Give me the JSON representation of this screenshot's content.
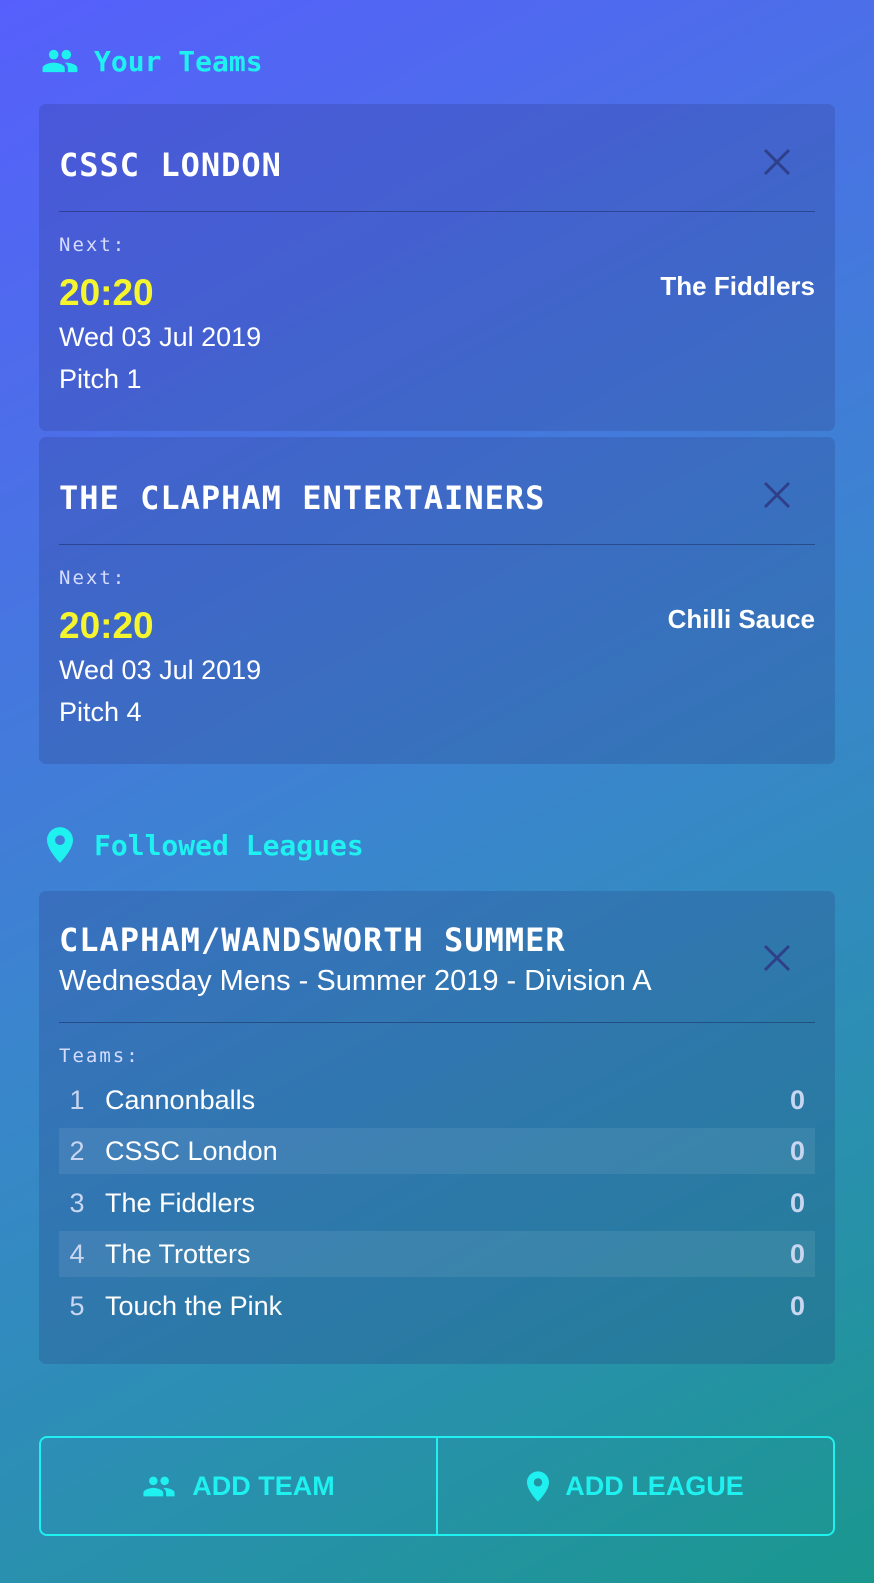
{
  "teams_section": {
    "title": "Your Teams",
    "icon": "people-icon"
  },
  "teams": [
    {
      "name": "CSSC LONDON",
      "next_label": "Next:",
      "time": "20:20",
      "date": "Wed 03 Jul 2019",
      "pitch": "Pitch 1",
      "opponent": "The Fiddlers"
    },
    {
      "name": "THE CLAPHAM ENTERTAINERS",
      "next_label": "Next:",
      "time": "20:20",
      "date": "Wed 03 Jul 2019",
      "pitch": "Pitch 4",
      "opponent": "Chilli Sauce"
    }
  ],
  "leagues_section": {
    "title": "Followed Leagues",
    "icon": "location-pin-icon"
  },
  "league": {
    "name": "CLAPHAM/WANDSWORTH SUMMER",
    "subtitle": "Wednesday Mens - Summer 2019 - Division A",
    "teams_label": "Teams:",
    "standings": [
      {
        "pos": "1",
        "team": "Cannonballs",
        "points": "0"
      },
      {
        "pos": "2",
        "team": "CSSC London",
        "points": "0"
      },
      {
        "pos": "3",
        "team": "The Fiddlers",
        "points": "0"
      },
      {
        "pos": "4",
        "team": "The Trotters",
        "points": "0"
      },
      {
        "pos": "5",
        "team": "Touch the Pink",
        "points": "0"
      }
    ]
  },
  "actions": {
    "add_team": "ADD TEAM",
    "add_league": "ADD LEAGUE"
  },
  "colors": {
    "accent": "#1ef1ef",
    "time": "#f5f52e",
    "close": "#2f3f8a"
  }
}
